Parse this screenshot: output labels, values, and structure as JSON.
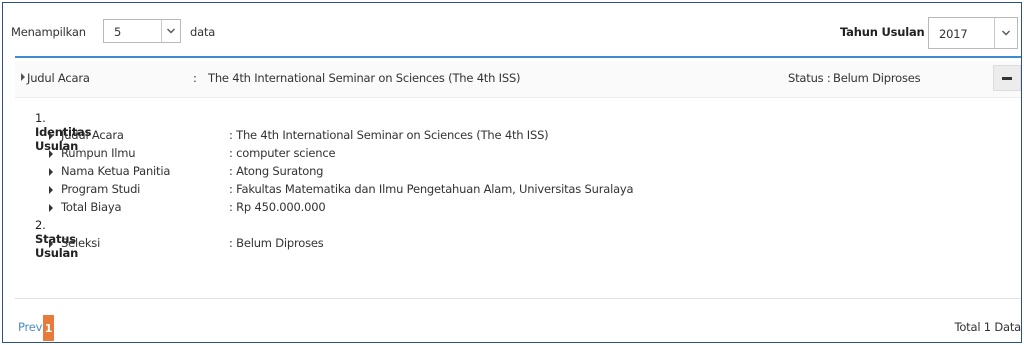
{
  "toolbar": {
    "show_label": "Menampilkan",
    "page_size": "5",
    "data_label": "data",
    "year_label": "Tahun Usulan",
    "year_value": "2017"
  },
  "item": {
    "header_label": "Judul Acara",
    "header_colon": ":",
    "header_value": "The 4th International Seminar on Sciences (The 4th ISS)",
    "status_prefix": "Status :",
    "status_value": "Belum Diproses"
  },
  "details": {
    "section1_num": "1.",
    "section1_title": "Identitas Usulan",
    "rows1": [
      {
        "label": "Judul Acara",
        "value": ": The 4th International Seminar on Sciences (The 4th ISS)"
      },
      {
        "label": "Rumpun Ilmu",
        "value": ": computer science"
      },
      {
        "label": "Nama Ketua Panitia",
        "value": ": Atong Suratong"
      },
      {
        "label": "Program Studi",
        "value": ": Fakultas Matematika dan Ilmu Pengetahuan Alam, Universitas Suralaya"
      },
      {
        "label": "Total Biaya",
        "value": ": Rp 450.000.000"
      }
    ],
    "section2_num": "2.",
    "section2_title": "Status Usulan",
    "rows2": [
      {
        "label": "Seleksi",
        "value": ": Belum Diproses"
      }
    ]
  },
  "pagination": {
    "prev_label": "Prev",
    "current_page": "1",
    "total_label": "Total 1 Data"
  }
}
